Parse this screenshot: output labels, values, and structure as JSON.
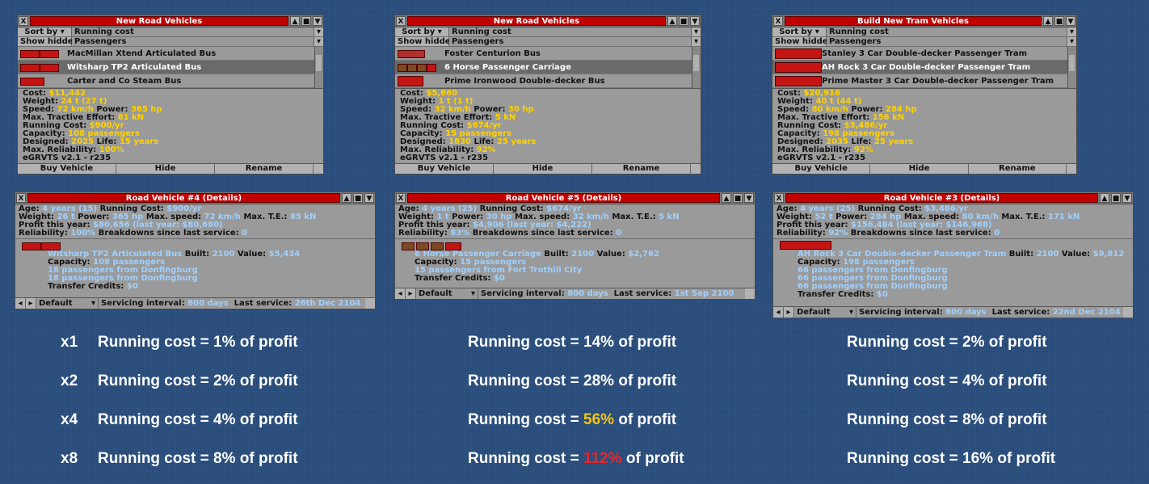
{
  "win_buttons": {
    "close": "X",
    "shade": "▲",
    "sticky": "■",
    "pin": "▼"
  },
  "build_windows": [
    {
      "title": "New Road Vehicles",
      "sort_label": "Sort by",
      "sort_value": "Running cost",
      "hidden_label": "Show hidden",
      "cargo_value": "Passengers",
      "items": [
        "MacMillan Xtend Articulated Bus",
        "Witsharp TP2 Articulated Bus",
        "Carter and Co Steam Bus"
      ],
      "cost": "$11,442",
      "weight": "24 t (27 t)",
      "speed": "72 km/h",
      "power": "365 hp",
      "tractive": "81 kN",
      "running_cost": "$900/yr",
      "capacity": "108 passengers",
      "designed": "2025",
      "life": "15 years",
      "reliability": "100%",
      "grf": "eGRVTS v2.1 - r235",
      "buttons": [
        "Buy Vehicle",
        "Hide",
        "Rename"
      ]
    },
    {
      "title": "New Road Vehicles",
      "sort_label": "Sort by",
      "sort_value": "Running cost",
      "hidden_label": "Show hidden",
      "cargo_value": "Passengers",
      "items": [
        "Foster Centurion Bus",
        "6 Horse Passenger Carriage",
        "Prime Ironwood Double-decker Bus"
      ],
      "cost": "$5,660",
      "weight": "1 t (1 t)",
      "speed": "32 km/h",
      "power": "30 hp",
      "tractive": "5 kN",
      "running_cost": "$674/yr",
      "capacity": "15 passengers",
      "designed": "1830",
      "life": "25 years",
      "reliability": "92%",
      "grf": "eGRVTS v2.1 - r235",
      "buttons": [
        "Buy Vehicle",
        "Hide",
        "Rename"
      ]
    },
    {
      "title": "Build New Tram Vehicles",
      "sort_label": "Sort by",
      "sort_value": "Running cost",
      "hidden_label": "Show hidden",
      "cargo_value": "Passengers",
      "items": [
        "Stanley 3 Car Double-decker Passenger Tram",
        "AH Rock 3 Car Double-decker Passenger Tram",
        "Prime Master 3 Car Double-decker Passenger Tram"
      ],
      "cost": "$20,916",
      "weight": "40 t (44 t)",
      "speed": "80 km/h",
      "power": "284 hp",
      "tractive": "156 kN",
      "running_cost": "$3,486/yr",
      "capacity": "198 passengers",
      "designed": "2035",
      "life": "25 years",
      "reliability": "92%",
      "grf": "eGRVTS v2.1 - r235",
      "buttons": [
        "Buy Vehicle",
        "Hide",
        "Rename"
      ]
    }
  ],
  "labels": {
    "cost": "Cost:",
    "weight": "Weight:",
    "speed": "Speed:",
    "power": "Power:",
    "tractive": "Max. Tractive Effort:",
    "running": "Running Cost:",
    "capacity": "Capacity:",
    "designed": "Designed:",
    "life": "Life:",
    "maxrel": "Max. Reliability:",
    "age": "Age:",
    "drc": "Running Cost:",
    "dweight": "Weight:",
    "dpower": "Power:",
    "maxspeed": "Max. speed:",
    "maxte": "Max. T.E.:",
    "profit": "Profit this year:",
    "lastyear": "(last year:",
    "rel": "Reliability:",
    "breakdowns": "Breakdowns since last service:",
    "built": "Built:",
    "value": "Value:",
    "dcap": "Capacity:",
    "transfer": "Transfer Credits:",
    "servicing": "Servicing interval:",
    "lastservice": "Last service:"
  },
  "detail_windows": [
    {
      "title": "Road Vehicle #4 (Details)",
      "age": "4 years (15)",
      "running_cost": "$900/yr",
      "weight": "26 t",
      "power": "365 hp",
      "max_speed": "72 km/h",
      "max_te": "85 kN",
      "profit": "$80,656",
      "last_year": "$80,680)",
      "reliability": "100%",
      "breakdowns": "0",
      "vehicle": "Witsharp TP2 Articulated Bus",
      "built": "2100",
      "value": "$5,434",
      "capacity": "108 passengers",
      "cargo_lines": [
        "18 passengers from Donfingburg",
        "18 passengers from Donfingburg"
      ],
      "transfer": "$0",
      "default_label": "Default",
      "interval": "800 days",
      "last_service": "26th Dec 2104"
    },
    {
      "title": "Road Vehicle #5 (Details)",
      "age": "4 years (25)",
      "running_cost": "$674/yr",
      "weight": "1 t",
      "power": "30 hp",
      "max_speed": "32 km/h",
      "max_te": "5 kN",
      "profit": "$4,906",
      "last_year": "$4,222)",
      "reliability": "83%",
      "breakdowns": "0",
      "vehicle": "6 Horse Passenger Carriage",
      "built": "2100",
      "value": "$2,762",
      "capacity": "15 passengers",
      "cargo_lines": [
        "15 passengers from Fort Trothill City"
      ],
      "transfer": "$0",
      "default_label": "Default",
      "interval": "800 days",
      "last_service": "1st Sep 2100"
    },
    {
      "title": "Road Vehicle #3 (Details)",
      "age": "4 years (25)",
      "running_cost": "$3,486/yr",
      "weight": "52 t",
      "power": "284 hp",
      "max_speed": "80 km/h",
      "max_te": "171 kN",
      "profit": "$156,484",
      "last_year": "$146,968)",
      "reliability": "92%",
      "breakdowns": "0",
      "vehicle": "AH Rock 3 Car Double-decker Passenger Tram",
      "built": "2100",
      "value": "$9,812",
      "capacity": "198 passengers",
      "cargo_lines": [
        "66 passengers from Donfingburg",
        "66 passengers from Donfingburg",
        "66 passengers from Donfingburg"
      ],
      "transfer": "$0",
      "default_label": "Default",
      "interval": "800 days",
      "last_service": "22nd Dec 2104"
    }
  ],
  "stats": {
    "multipliers": [
      "x1",
      "x2",
      "x4",
      "x8"
    ],
    "prefix": "Running cost =",
    "suffix": "of profit",
    "columns": [
      [
        "1%",
        "2%",
        "4%",
        "8%"
      ],
      [
        "14%",
        "28%",
        "56%",
        "112%"
      ],
      [
        "2%",
        "4%",
        "8%",
        "16%"
      ]
    ],
    "highlight_colors": {
      "warning": "#f5c518",
      "danger": "#e8262c"
    }
  }
}
